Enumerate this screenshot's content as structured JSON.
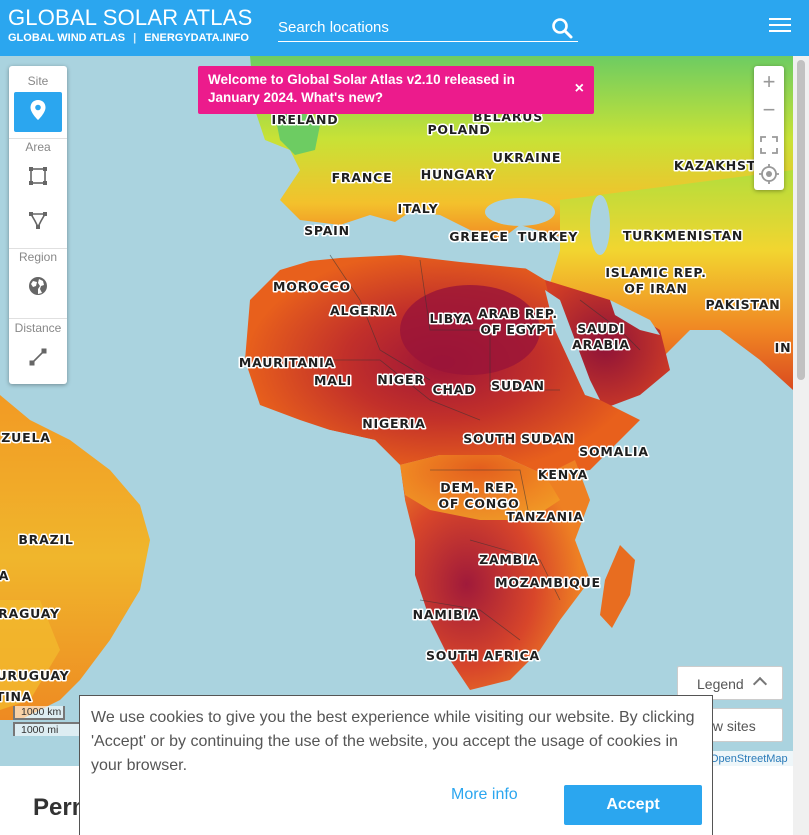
{
  "header": {
    "title": "GLOBAL SOLAR ATLAS",
    "links": [
      "GLOBAL WIND ATLAS",
      "ENERGYDATA.INFO"
    ],
    "search_placeholder": "Search locations"
  },
  "toolbox": {
    "sections": [
      {
        "label": "Site",
        "tools": [
          "marker-icon"
        ]
      },
      {
        "label": "Area",
        "tools": [
          "rectangle-select-icon",
          "polygon-select-icon"
        ]
      },
      {
        "label": "Region",
        "tools": [
          "globe-icon"
        ]
      },
      {
        "label": "Distance",
        "tools": [
          "ruler-icon"
        ]
      }
    ]
  },
  "zoom": {
    "in": "+",
    "out": "−"
  },
  "notice": {
    "text": "Welcome to Global Solar Atlas v2.10 released in January 2024. What's new?",
    "close": "×"
  },
  "map": {
    "country_labels": [
      "IRELAND",
      "BELARUS",
      "POLAND",
      "UKRAINE",
      "KAZAKHST",
      "FRANCE",
      "HUNGARY",
      "ITALY",
      "SPAIN",
      "GREECE",
      "TURKEY",
      "TURKMENISTAN",
      "MOROCCO",
      "ISLAMIC REP.",
      "OF IRAN",
      "ALGERIA",
      "LIBYA",
      "ARAB REP.",
      "OF EGYPT",
      "SAUDI",
      "ARABIA",
      "PAKISTAN",
      "IN",
      "MAURITANIA",
      "MALI",
      "NIGER",
      "CHAD",
      "SUDAN",
      "NIGERIA",
      "ZUELA",
      "SOUTH SUDAN",
      "SOMALIA",
      "KENYA",
      "DEM. REP.",
      "OF CONGO",
      "TANZANIA",
      "BRAZIL",
      "ZAMBIA",
      "MOZAMBIQUE",
      "A",
      "NAMIBIA",
      "RAGUAY",
      "SOUTH AFRICA",
      "URUGUAY",
      "TINA"
    ],
    "scale_km": "1000 km",
    "scale_mi": "1000 mi",
    "attribution": "OpenStreetMap",
    "colors": {
      "ocean": "#aad3df",
      "low": "#7cd35a",
      "mid": "#f5e13a",
      "high": "#f07a1e",
      "peak": "#a0163a"
    }
  },
  "legend": {
    "label": "Legend"
  },
  "show_sites": {
    "label": "Show sites"
  },
  "page": {
    "section_title": "Perm"
  },
  "cookie": {
    "text": "We use cookies to give you the best experience while visiting our website. By clicking 'Accept' or by continuing the use of the website, you accept the usage of cookies in your browser.",
    "more_info": "More info",
    "accept": "Accept"
  }
}
